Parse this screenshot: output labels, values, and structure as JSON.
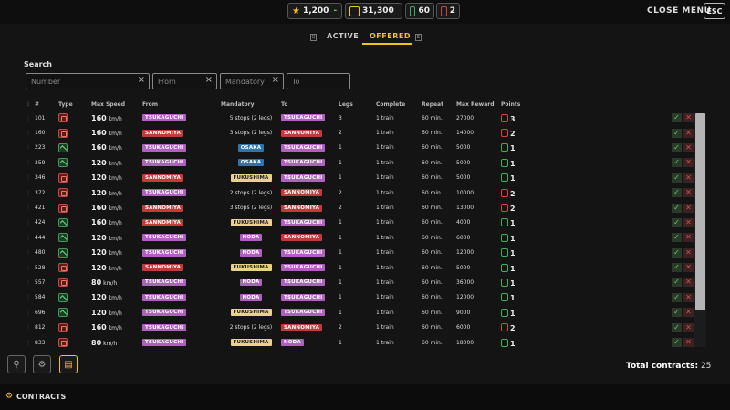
{
  "topbar": {
    "stars": "1,200",
    "stars_delta": "-",
    "money": "31,300",
    "trains_green": "60",
    "trains_red": "2",
    "close_menu": "CLOSE MENU",
    "esc": "ESC"
  },
  "tabs": {
    "active_key": "Q",
    "active": "ACTIVE",
    "offered": "OFFERED",
    "offered_key": "E"
  },
  "search": {
    "label": "Search",
    "number_placeholder": "Number",
    "from_placeholder": "From",
    "mandatory_placeholder": "Mandatory",
    "to_placeholder": "To",
    "clear": "×"
  },
  "table": {
    "headers": {
      "num": "#",
      "type": "Type",
      "max_speed": "Max Speed",
      "from": "From",
      "mandatory": "Mandatory",
      "to": "To",
      "legs": "Legs",
      "complete": "Complete",
      "repeat": "Repeat",
      "max_reward": "Max Reward",
      "points": "Points"
    },
    "unit": "km/h",
    "rows": [
      {
        "num": "101",
        "type": "r",
        "speed": "160",
        "from": "TSUKAGUCHI",
        "from_c": "pk",
        "mand": "5 stops (2 legs)",
        "mand_c": "",
        "to": "TSUKAGUCHI",
        "to_c": "pk",
        "legs": "3",
        "complete": "1 train",
        "repeat": "60 min.",
        "reward": "27000",
        "pts_c": "r",
        "pts": "3"
      },
      {
        "num": "160",
        "type": "r",
        "speed": "160",
        "from": "SANNOMIYA",
        "from_c": "rd",
        "mand": "3 stops (2 legs)",
        "mand_c": "",
        "to": "SANNOMIYA",
        "to_c": "rd",
        "legs": "2",
        "complete": "1 train",
        "repeat": "60 min.",
        "reward": "14000",
        "pts_c": "r",
        "pts": "2"
      },
      {
        "num": "223",
        "type": "g",
        "speed": "160",
        "from": "TSUKAGUCHI",
        "from_c": "pk",
        "mand": "OSAKA",
        "mand_c": "bl",
        "to": "TSUKAGUCHI",
        "to_c": "pk",
        "legs": "1",
        "complete": "1 train",
        "repeat": "60 min.",
        "reward": "5000",
        "pts_c": "g",
        "pts": "1"
      },
      {
        "num": "259",
        "type": "g",
        "speed": "120",
        "from": "TSUKAGUCHI",
        "from_c": "pk",
        "mand": "OSAKA",
        "mand_c": "bl",
        "to": "TSUKAGUCHI",
        "to_c": "pk",
        "legs": "1",
        "complete": "1 train",
        "repeat": "60 min.",
        "reward": "5000",
        "pts_c": "g",
        "pts": "1"
      },
      {
        "num": "346",
        "type": "r",
        "speed": "120",
        "from": "SANNOMIYA",
        "from_c": "rd",
        "mand": "FUKUSHIMA",
        "mand_c": "yl",
        "to": "TSUKAGUCHI",
        "to_c": "pk",
        "legs": "1",
        "complete": "1 train",
        "repeat": "60 min.",
        "reward": "5000",
        "pts_c": "g",
        "pts": "1"
      },
      {
        "num": "372",
        "type": "r",
        "speed": "120",
        "from": "TSUKAGUCHI",
        "from_c": "pk",
        "mand": "2 stops (2 legs)",
        "mand_c": "",
        "to": "SANNOMIYA",
        "to_c": "rd",
        "legs": "2",
        "complete": "1 train",
        "repeat": "60 min.",
        "reward": "10000",
        "pts_c": "r",
        "pts": "2"
      },
      {
        "num": "421",
        "type": "r",
        "speed": "160",
        "from": "SANNOMIYA",
        "from_c": "rd",
        "mand": "3 stops (2 legs)",
        "mand_c": "",
        "to": "SANNOMIYA",
        "to_c": "rd",
        "legs": "2",
        "complete": "1 train",
        "repeat": "60 min.",
        "reward": "13000",
        "pts_c": "r",
        "pts": "2"
      },
      {
        "num": "424",
        "type": "g",
        "speed": "160",
        "from": "SANNOMIYA",
        "from_c": "rd",
        "mand": "FUKUSHIMA",
        "mand_c": "yl",
        "to": "TSUKAGUCHI",
        "to_c": "pk",
        "legs": "1",
        "complete": "1 train",
        "repeat": "60 min.",
        "reward": "4000",
        "pts_c": "g",
        "pts": "1"
      },
      {
        "num": "444",
        "type": "g",
        "speed": "120",
        "from": "TSUKAGUCHI",
        "from_c": "pk",
        "mand": "NODA",
        "mand_c": "pk",
        "to": "SANNOMIYA",
        "to_c": "rd",
        "legs": "1",
        "complete": "1 train",
        "repeat": "60 min.",
        "reward": "6000",
        "pts_c": "g",
        "pts": "1"
      },
      {
        "num": "480",
        "type": "g",
        "speed": "120",
        "from": "TSUKAGUCHI",
        "from_c": "pk",
        "mand": "NODA",
        "mand_c": "pk",
        "to": "TSUKAGUCHI",
        "to_c": "pk",
        "legs": "1",
        "complete": "1 train",
        "repeat": "60 min.",
        "reward": "12000",
        "pts_c": "g",
        "pts": "1"
      },
      {
        "num": "528",
        "type": "r",
        "speed": "120",
        "from": "SANNOMIYA",
        "from_c": "rd",
        "mand": "FUKUSHIMA",
        "mand_c": "yl",
        "to": "TSUKAGUCHI",
        "to_c": "pk",
        "legs": "1",
        "complete": "1 train",
        "repeat": "60 min.",
        "reward": "5000",
        "pts_c": "g",
        "pts": "1"
      },
      {
        "num": "557",
        "type": "r",
        "speed": "80",
        "from": "TSUKAGUCHI",
        "from_c": "pk",
        "mand": "NODA",
        "mand_c": "pk",
        "to": "TSUKAGUCHI",
        "to_c": "pk",
        "legs": "1",
        "complete": "1 train",
        "repeat": "60 min.",
        "reward": "36000",
        "pts_c": "g",
        "pts": "1"
      },
      {
        "num": "584",
        "type": "g",
        "speed": "120",
        "from": "TSUKAGUCHI",
        "from_c": "pk",
        "mand": "NODA",
        "mand_c": "pk",
        "to": "TSUKAGUCHI",
        "to_c": "pk",
        "legs": "1",
        "complete": "1 train",
        "repeat": "60 min.",
        "reward": "12000",
        "pts_c": "g",
        "pts": "1"
      },
      {
        "num": "696",
        "type": "g",
        "speed": "120",
        "from": "TSUKAGUCHI",
        "from_c": "pk",
        "mand": "FUKUSHIMA",
        "mand_c": "yl",
        "to": "TSUKAGUCHI",
        "to_c": "pk",
        "legs": "1",
        "complete": "1 train",
        "repeat": "60 min.",
        "reward": "9000",
        "pts_c": "g",
        "pts": "1"
      },
      {
        "num": "812",
        "type": "r",
        "speed": "160",
        "from": "TSUKAGUCHI",
        "from_c": "pk",
        "mand": "2 stops (2 legs)",
        "mand_c": "",
        "to": "SANNOMIYA",
        "to_c": "rd",
        "legs": "2",
        "complete": "1 train",
        "repeat": "60 min.",
        "reward": "6000",
        "pts_c": "r",
        "pts": "2"
      },
      {
        "num": "833",
        "type": "r",
        "speed": "80",
        "from": "TSUKAGUCHI",
        "from_c": "pk",
        "mand": "FUKUSHIMA",
        "mand_c": "yl",
        "to": "NODA",
        "to_c": "pk",
        "legs": "1",
        "complete": "1 train",
        "repeat": "60 min.",
        "reward": "18000",
        "pts_c": "g",
        "pts": "1"
      }
    ],
    "accept": "✓",
    "reject": "✕"
  },
  "footer": {
    "total_label": "Total contracts:",
    "total_value": "25",
    "contracts": "CONTRACTS"
  },
  "colors": {
    "accent": "#f0c419",
    "station_pink": "#b060bf",
    "station_red": "#c33a3a",
    "station_blue": "#2f74ae",
    "station_yellow": "#e8d28a"
  }
}
